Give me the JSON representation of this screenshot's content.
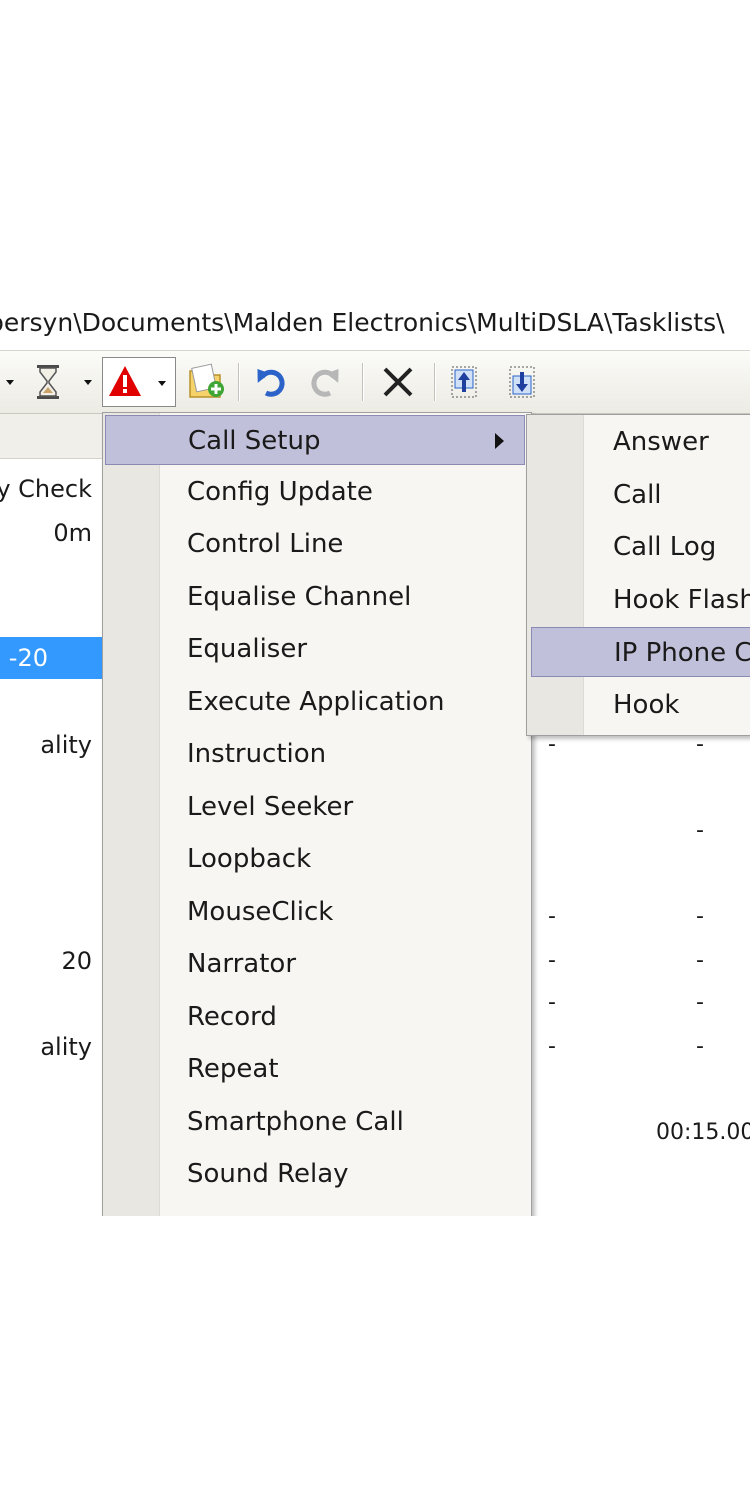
{
  "window": {
    "title_path": "persyn\\Documents\\Malden Electronics\\MultiDSLA\\Tasklists\\"
  },
  "toolbar": {
    "icons": [
      "dropdown-arrow-icon",
      "hourglass-icon",
      "dropdown-arrow-icon",
      "warning-triangle-icon",
      "dropdown-arrow-icon",
      "new-task-icon",
      "undo-icon",
      "redo-icon",
      "delete-icon",
      "move-up-icon",
      "move-down-icon"
    ]
  },
  "task_list": {
    "rows": [
      {
        "text": "y Check",
        "selected": false
      },
      {
        "text": "0m",
        "selected": false
      },
      {
        "text": "-20",
        "selected": true
      },
      {
        "text": "ality",
        "selected": false
      },
      {
        "text": "20",
        "selected": false
      },
      {
        "text": "ality",
        "selected": false
      }
    ],
    "dashes": [
      "-",
      "-",
      "-",
      "-",
      "-",
      "-",
      "-",
      "-",
      "-",
      "-",
      "-"
    ],
    "time": "00:15.00"
  },
  "context_menu": {
    "items": [
      {
        "label": "Call Setup",
        "highlighted": true,
        "has_submenu": true
      },
      {
        "label": "Config Update"
      },
      {
        "label": "Control Line"
      },
      {
        "label": "Equalise Channel"
      },
      {
        "label": "Equaliser"
      },
      {
        "label": "Execute Application"
      },
      {
        "label": "Instruction"
      },
      {
        "label": "Level Seeker"
      },
      {
        "label": "Loopback"
      },
      {
        "label": "MouseClick"
      },
      {
        "label": "Narrator"
      },
      {
        "label": "Record"
      },
      {
        "label": "Repeat"
      },
      {
        "label": "Smartphone Call"
      },
      {
        "label": "Sound Relay"
      }
    ]
  },
  "submenu": {
    "items": [
      {
        "label": "Answer"
      },
      {
        "label": "Call"
      },
      {
        "label": "Call Log"
      },
      {
        "label": "Hook Flash"
      },
      {
        "label": "IP Phone C",
        "highlighted": true
      },
      {
        "label": "Hook"
      }
    ]
  },
  "colors": {
    "selection_blue": "#3399ff",
    "menu_highlight": "#c1c0da",
    "alert_red": "#e00000"
  }
}
